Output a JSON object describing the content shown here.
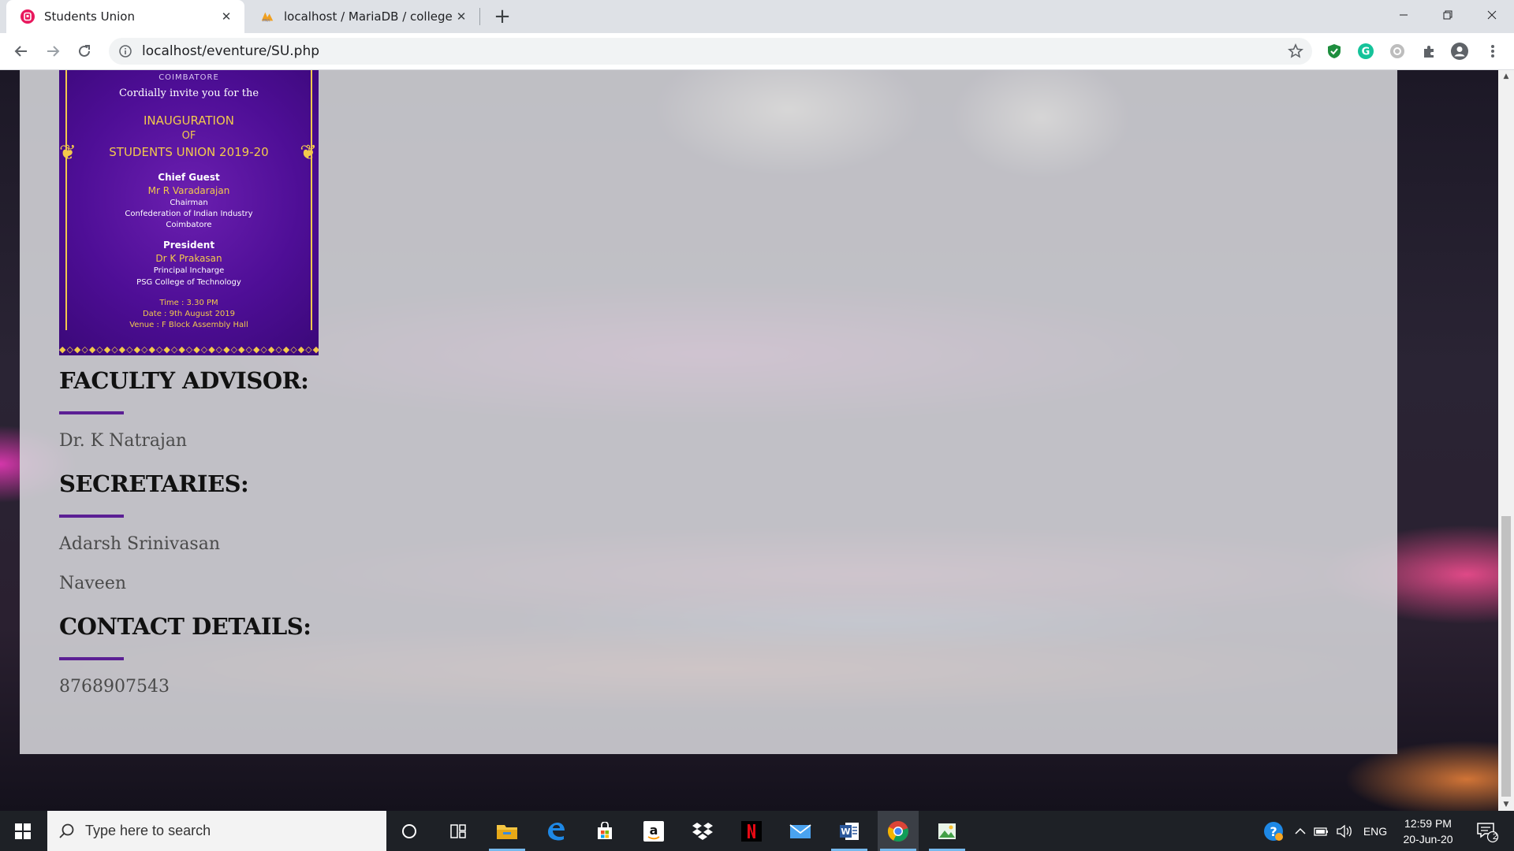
{
  "browser": {
    "tabs": [
      {
        "title": "Students Union",
        "favicon": "tab-app-icon",
        "accent": "#e8185d"
      },
      {
        "title": "localhost / MariaDB / collegeforu",
        "favicon": "phpmyadmin-icon"
      }
    ],
    "url": "localhost/eventure/SU.php",
    "extensions": [
      "shield-extension-icon",
      "grammarly-icon",
      "circle-extension-icon",
      "puzzle-icon",
      "profile-icon",
      "menu-dots-icon"
    ]
  },
  "poster": {
    "college_line": "COIMBATORE",
    "invite": "Cordially invite you for the",
    "event_line1": "INAUGURATION",
    "event_line2": "OF",
    "event_line3": "STUDENTS UNION 2019-20",
    "chief_guest_label": "Chief Guest",
    "chief_guest_name": "Mr R Varadarajan",
    "chief_guest_role1": "Chairman",
    "chief_guest_role2": "Confederation of Indian Industry",
    "chief_guest_role3": "Coimbatore",
    "president_label": "President",
    "president_name": "Dr K Prakasan",
    "president_role1": "Principal Incharge",
    "president_role2": "PSG College of Technology",
    "time": "Time : 3.30 PM",
    "date": "Date : 9th August 2019",
    "venue": "Venue : F Block Assembly Hall",
    "border_pattern": "◆◇◆◇◆◇◆◇◆◇◆◇◆◇◆◇◆◇◆◇◆◇◆◇◆◇◆◇◆◇◆◇◆◇◆◇◆◇◆",
    "gold": "#f2c94c",
    "purple": "#4e0e96"
  },
  "sections": {
    "faculty_heading": "FACULTY ADVISOR:",
    "faculty_name": "Dr. K Natrajan",
    "secretaries_heading": "SECRETARIES:",
    "secretary_1": "Adarsh Srinivasan",
    "secretary_2": "Naveen",
    "contact_heading": "CONTACT DETAILS:",
    "phone": "8768907543",
    "accent": "#5b1f94"
  },
  "taskbar": {
    "search_placeholder": "Type here to search",
    "apps": [
      "cortana-icon",
      "task-view-icon",
      "file-explorer-icon",
      "edge-icon",
      "store-icon",
      "amazon-icon",
      "dropbox-icon",
      "netflix-icon",
      "mail-icon",
      "word-icon",
      "chrome-icon",
      "image-app-icon"
    ],
    "language": "ENG",
    "time": "12:59 PM",
    "date": "20-Jun-20",
    "notification_count": "2"
  }
}
